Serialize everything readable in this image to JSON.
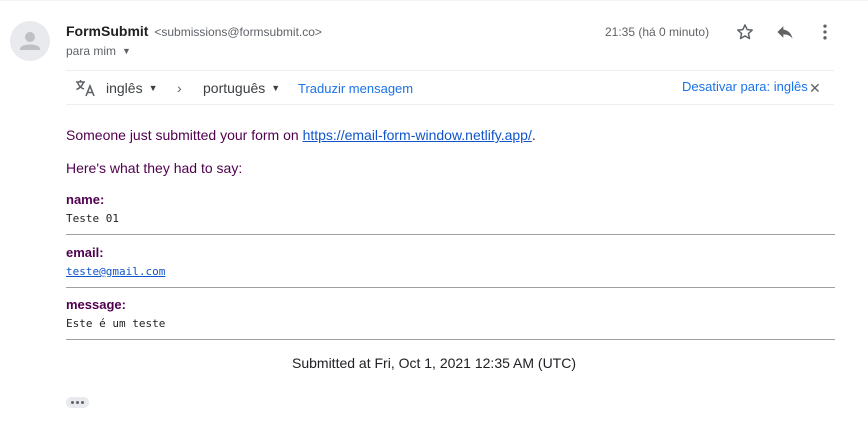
{
  "header": {
    "sender_name": "FormSubmit",
    "sender_email": "<submissions@formsubmit.co>",
    "recipient": "para mim",
    "time": "21:35 (há 0 minuto)"
  },
  "translate_bar": {
    "source_language": "inglês",
    "target_language": "português",
    "translate_link": "Traduzir mensagem",
    "disable_link": "Desativar para: inglês"
  },
  "body": {
    "intro_text": "Someone just submitted your form on ",
    "intro_link": "https://email-form-window.netlify.app/",
    "intro_end": ".",
    "subtitle": "Here's what they had to say:",
    "fields": [
      {
        "label": "name:",
        "value": "Teste 01"
      },
      {
        "label": "email:",
        "value": "teste@gmail.com"
      },
      {
        "label": "message:",
        "value": "Este é um teste"
      }
    ],
    "submitted_at": "Submitted at Fri, Oct 1, 2021 12:35 AM (UTC)"
  },
  "icons": {
    "avatar": "person-icon",
    "star": "star-icon",
    "reply": "reply-icon",
    "more": "more-vert-icon",
    "translate": "translate-icon",
    "chevron": "chevron-right-icon",
    "close": "close-icon",
    "ellipsis": "more-horiz-icon"
  },
  "colors": {
    "link": "#1155cc",
    "accent": "#1a73e8",
    "email_text": "#50004f"
  }
}
